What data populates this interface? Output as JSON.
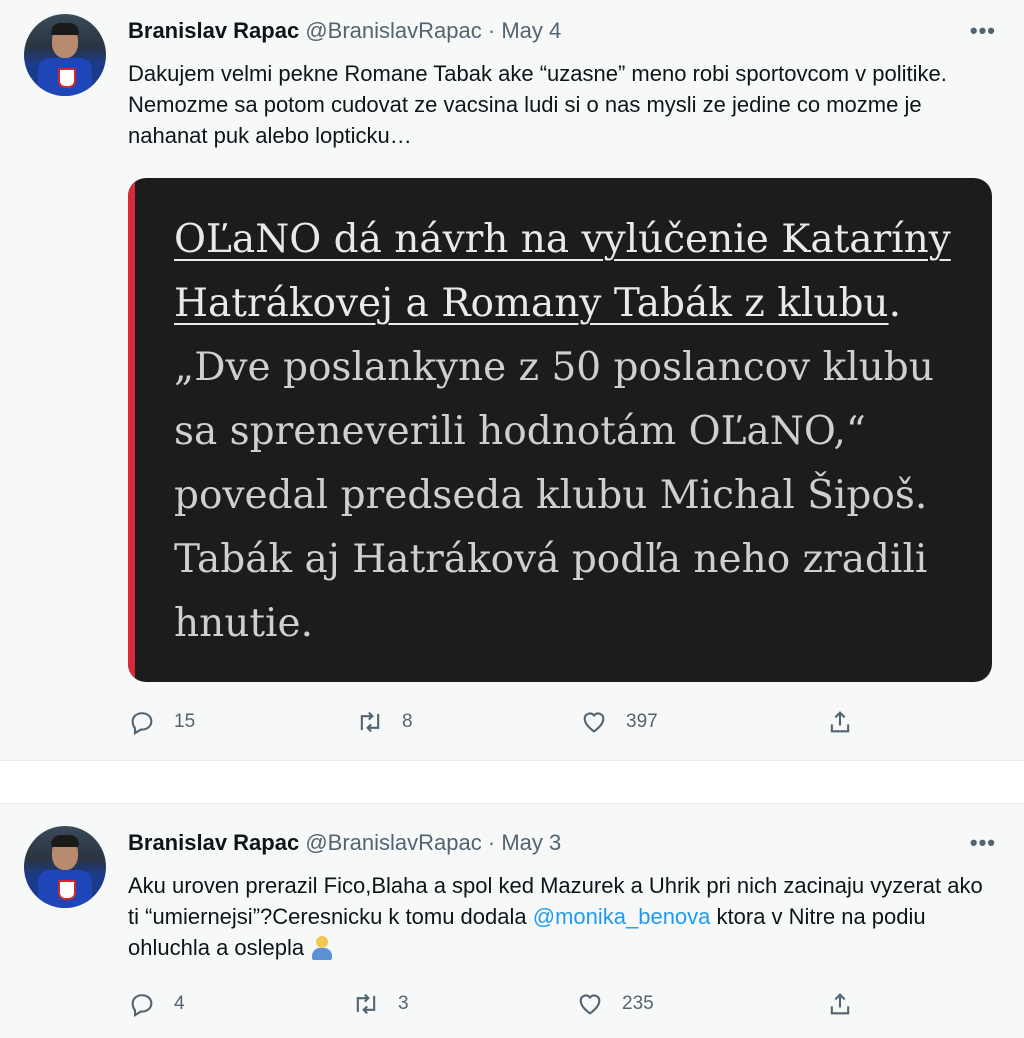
{
  "tweets": [
    {
      "name": "Branislav Rapac",
      "handle": "@BranislavRapac",
      "separator": "·",
      "date": "May 4",
      "more": "•••",
      "text": "Dakujem velmi pekne Romane Tabak ake “uzasne” meno robi sportovcom v politike. Nemozme sa potom cudovat ze vacsina ludi si o nas mysli ze jedine co mozme je nahanat puk alebo lopticku…",
      "card": {
        "headline": "OĽaNO dá návrh na vylúčenie Kataríny Hatrákovej a Romany Tabák z klubu",
        "headline_end": ".",
        "quote": "„Dve poslankyne z 50 poslancov klubu sa spreneverili hodnotám OĽaNO,“ povedal predseda klubu Michal Šipoš. Tabák aj Hatráková podľa neho zradili hnutie."
      },
      "replies": "15",
      "retweets": "8",
      "likes": "397"
    },
    {
      "name": "Branislav Rapac",
      "handle": "@BranislavRapac",
      "separator": "·",
      "date": "May 3",
      "more": "•••",
      "text_before": "Aku uroven prerazil Fico,Blaha a spol ked Mazurek a Uhrik pri nich zacinaju vyzerat ako ti “umiernejsi”?Ceresnicku k tomu dodala ",
      "mention": "@monika_benova",
      "text_after": " ktora v Nitre na podiu ohluchla a oslepla",
      "emoji": "person-shrugging",
      "replies": "4",
      "retweets": "3",
      "likes": "235"
    }
  ],
  "icons": {
    "reply": "reply-icon",
    "retweet": "retweet-icon",
    "like": "heart-icon",
    "share": "share-icon",
    "more": "more-icon"
  },
  "colors": {
    "accent": "#1d9bf0",
    "card_bar": "#d62a3a",
    "card_bg": "#1c1c1c"
  }
}
